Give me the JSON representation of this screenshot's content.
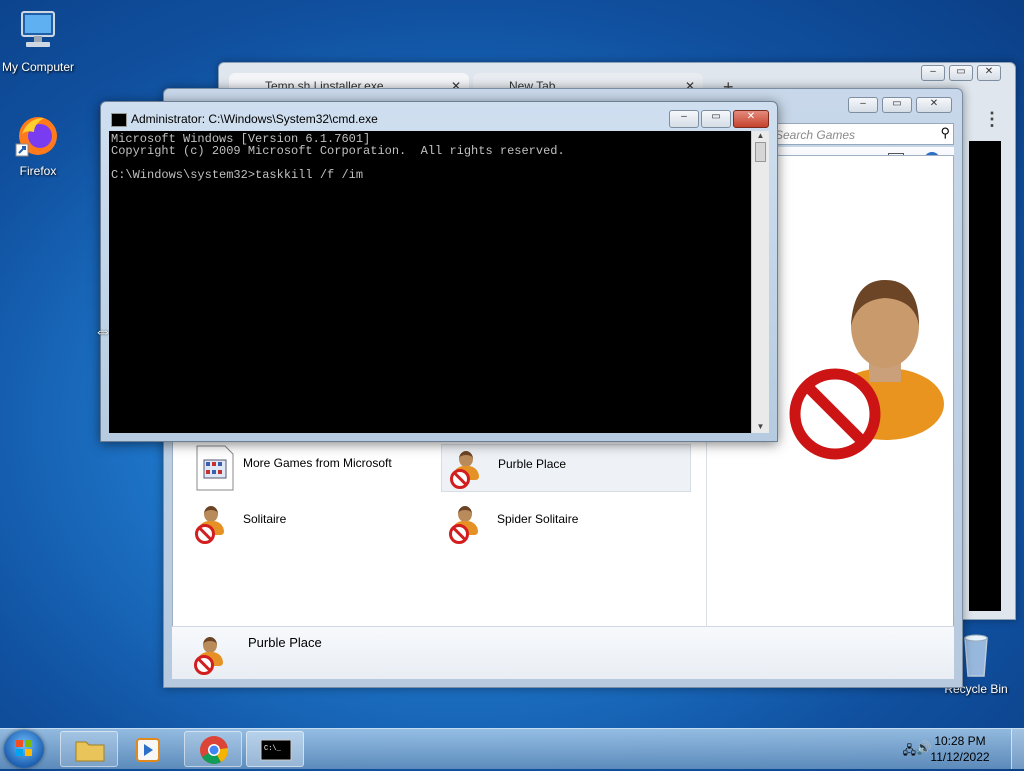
{
  "desktop": {
    "icons": [
      {
        "label": "My Computer"
      },
      {
        "label": "Firefox"
      },
      {
        "label": "Recycle Bin"
      }
    ]
  },
  "browser": {
    "tabs": [
      {
        "label": "Temp.sh | installer.exe"
      },
      {
        "label": "New Tab"
      }
    ],
    "new_tab_label": "+"
  },
  "explorer": {
    "search_placeholder": "Search Games",
    "games": [
      {
        "label": "More Games from Microsoft"
      },
      {
        "label": "Purble Place"
      },
      {
        "label": "Solitaire"
      },
      {
        "label": "Spider Solitaire"
      }
    ],
    "details_name": "Purble Place"
  },
  "cmd": {
    "title": "Administrator: C:\\Windows\\System32\\cmd.exe",
    "lines": [
      "Microsoft Windows [Version 6.1.7601]",
      "Copyright (c) 2009 Microsoft Corporation.  All rights reserved.",
      "",
      "C:\\Windows\\system32>taskkill /f /im"
    ]
  },
  "taskbar": {
    "time": "10:28 PM",
    "date": "11/12/2022"
  },
  "colors": {
    "desktop_blue": "#1f78cc",
    "cmd_background": "#000000",
    "cmd_text": "#c0c0c0",
    "close_button": "#c4432d"
  }
}
